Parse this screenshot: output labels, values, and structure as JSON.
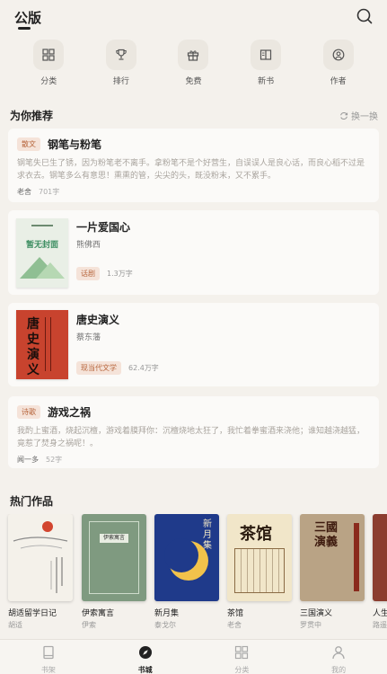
{
  "header": {
    "tab_label": "公版"
  },
  "categories": [
    {
      "label": "分类",
      "icon": "grid-icon"
    },
    {
      "label": "排行",
      "icon": "trophy-icon"
    },
    {
      "label": "免费",
      "icon": "gift-icon"
    },
    {
      "label": "新书",
      "icon": "book-open-icon"
    },
    {
      "label": "作者",
      "icon": "user-circle-icon"
    }
  ],
  "recommend": {
    "title": "为你推荐",
    "swap_label": "换一换",
    "items": [
      {
        "tag": "散文",
        "title": "钢笔与粉笔",
        "excerpt": "钢笔失巳生了锈，因为粉笔老不离手。拿粉笔不是个好营生，自误误人是良心话，而良心稻不过是求衣去。钢笔多么有意思！熏熏的管，尖尖的头，既没粉末，又不累手。",
        "author": "老舍",
        "count": "701字"
      },
      {
        "title": "一片爱国心",
        "author": "熊佛西",
        "tag": "话剧",
        "count": "1.3万字",
        "cover_text": "暂无封面"
      },
      {
        "title": "唐史演义",
        "author": "蔡东藩",
        "tag": "现当代文学",
        "count": "62.4万字",
        "cover_text": "唐史演义"
      },
      {
        "tag": "诗歌",
        "title": "游戏之祸",
        "excerpt": "我酌上蜜酒，烧起沉檀，游戏着膜拜你：沉檀烧地太狂了，我忙着拳蜜酒来浇他；谁知越浇越猛，竟惹了焚身之祸呢！。",
        "author": "闻一多",
        "count": "52字"
      }
    ]
  },
  "hot": {
    "title": "热门作品",
    "items": [
      {
        "title": "胡适留学日记",
        "author": "胡适"
      },
      {
        "title": "伊索寓言",
        "author": "伊索",
        "cover_text": "伊索寓言"
      },
      {
        "title": "新月集",
        "author": "泰戈尔",
        "cover_text": "新月集"
      },
      {
        "title": "茶馆",
        "author": "老舍",
        "cover_text": "茶馆"
      },
      {
        "title": "三国演义",
        "author": "罗贯中",
        "cover_text": "三國演義"
      },
      {
        "title": "人生",
        "author": "路遥"
      }
    ]
  },
  "nav": [
    {
      "label": "书架",
      "icon": "bookshelf-icon",
      "active": false
    },
    {
      "label": "书城",
      "icon": "compass-icon",
      "active": true
    },
    {
      "label": "分类",
      "icon": "grid-icon",
      "active": false
    },
    {
      "label": "我的",
      "icon": "user-icon",
      "active": false
    }
  ]
}
